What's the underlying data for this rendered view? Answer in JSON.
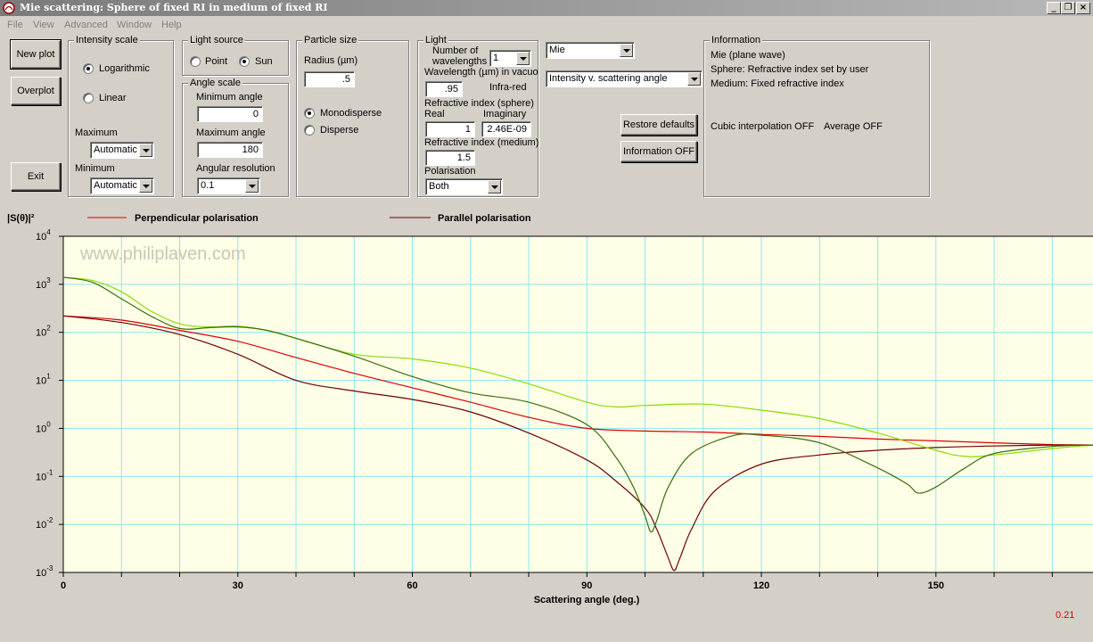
{
  "window": {
    "title": "Mie scattering:  Sphere of fixed RI in medium of fixed RI",
    "controls": {
      "minimize": "_",
      "restore": "❐",
      "close": "×"
    }
  },
  "menu": [
    "File",
    "View",
    "Advanced",
    "Window",
    "Help"
  ],
  "buttons": {
    "new_plot": "New plot",
    "overplot": "Overplot",
    "exit": "Exit",
    "restore_defaults": "Restore defaults",
    "information_off": "Information OFF"
  },
  "intensity_scale": {
    "legend": "Intensity scale",
    "logarithmic": "Logarithmic",
    "linear": "Linear",
    "selected": "Logarithmic",
    "maximum_label": "Maximum",
    "maximum_value": "Automatic",
    "minimum_label": "Minimum",
    "minimum_value": "Automatic"
  },
  "light_source": {
    "legend": "Light source",
    "point": "Point",
    "sun": "Sun",
    "selected": "Sun"
  },
  "angle_scale": {
    "legend": "Angle scale",
    "min_label": "Minimum angle",
    "min_value": "0",
    "max_label": "Maximum angle",
    "max_value": "180",
    "res_label": "Angular resolution",
    "res_value": "0.1"
  },
  "particle_size": {
    "legend": "Particle size",
    "radius_label": "Radius (µm)",
    "radius_value": ".5",
    "monodisperse": "Monodisperse",
    "disperse": "Disperse",
    "selected": "Monodisperse"
  },
  "light": {
    "legend": "Light",
    "num_wl_label_1": "Number of",
    "num_wl_label_2": "wavelengths",
    "num_wl_value": "1",
    "wavelength_label": "Wavelength (µm) in vacuo",
    "wavelength_value": ".95",
    "band": "Infra-red",
    "ri_sphere_label": "Refractive index (sphere)",
    "real_label": "Real",
    "imag_label": "Imaginary",
    "real_value": "1",
    "imag_value": "2.46E-09",
    "ri_medium_label": "Refractive index (medium)",
    "ri_medium_value": "1.5",
    "polarisation_label": "Polarisation",
    "polarisation_value": "Both"
  },
  "model": {
    "theory": "Mie",
    "plot_type": "Intensity v. scattering angle"
  },
  "information": {
    "legend": "Information",
    "line1": "Mie (plane wave)",
    "line2": "Sphere: Refractive index set by user",
    "line3": "Medium: Fixed refractive index",
    "cubic": "Cubic interpolation OFF",
    "average": "Average OFF"
  },
  "colors": {
    "plot_bg": "#ffffe8",
    "grid": "#88e8f0",
    "perp_red": "#dd0000",
    "par_dark": "#700000",
    "green_light": "#88dd00",
    "green_dark": "#3a6e0a"
  },
  "legend": {
    "perpendicular": "Perpendicular polarisation",
    "parallel": "Parallel polarisation"
  },
  "watermark": "www.philiplaven.com",
  "status_value": "0.21",
  "chart_data": {
    "type": "line",
    "ylabel": "|S(θ)|²",
    "xlabel": "Scattering angle (deg.)",
    "xlim": [
      0,
      177
    ],
    "ylim_log10": [
      -3,
      4
    ],
    "y_scale": "log",
    "grid": true,
    "legend_placement": "top",
    "x_ticks": [
      0,
      30,
      60,
      90,
      120,
      150
    ],
    "y_tick_exponents": [
      -3,
      -2,
      -1,
      0,
      1,
      2,
      3,
      4
    ],
    "series": [
      {
        "name": "Perpendicular polarisation",
        "color": "#dd0000",
        "x": [
          0,
          10,
          20,
          30,
          40,
          50,
          60,
          70,
          80,
          90,
          100,
          110,
          120,
          130,
          140,
          150,
          160,
          170,
          177
        ],
        "y": [
          220,
          180,
          110,
          65,
          30,
          14,
          7,
          3.5,
          1.7,
          1.0,
          0.88,
          0.84,
          0.75,
          0.68,
          0.6,
          0.55,
          0.5,
          0.46,
          0.45
        ]
      },
      {
        "name": "Parallel polarisation",
        "color": "#700000",
        "x": [
          0,
          10,
          20,
          30,
          40,
          50,
          60,
          70,
          80,
          90,
          95,
          100,
          102,
          104,
          105,
          106,
          108,
          112,
          120,
          130,
          140,
          150,
          160,
          170,
          177
        ],
        "y": [
          220,
          160,
          90,
          35,
          10,
          6,
          4,
          2.2,
          0.8,
          0.22,
          0.08,
          0.022,
          0.008,
          0.002,
          0.0011,
          0.002,
          0.008,
          0.05,
          0.18,
          0.28,
          0.35,
          0.4,
          0.43,
          0.45,
          0.45
        ]
      },
      {
        "name": "",
        "color": "#88dd00",
        "x": [
          0,
          5,
          10,
          15,
          20,
          25,
          30,
          35,
          40,
          50,
          60,
          70,
          80,
          90,
          95,
          100,
          110,
          120,
          130,
          140,
          150,
          155,
          160,
          170,
          177
        ],
        "y": [
          1400,
          1200,
          700,
          280,
          150,
          130,
          135,
          110,
          75,
          35,
          28,
          18,
          8.5,
          3.5,
          2.8,
          3.0,
          3.2,
          2.4,
          1.6,
          0.8,
          0.35,
          0.26,
          0.28,
          0.38,
          0.45
        ]
      },
      {
        "name": "",
        "color": "#3a6e0a",
        "x": [
          0,
          5,
          10,
          15,
          20,
          25,
          30,
          35,
          40,
          50,
          60,
          70,
          80,
          90,
          95,
          98,
          100,
          101,
          102,
          104,
          108,
          115,
          120,
          130,
          140,
          145,
          147,
          150,
          155,
          160,
          170,
          177
        ],
        "y": [
          1400,
          1100,
          500,
          220,
          120,
          125,
          130,
          110,
          75,
          32,
          12,
          5.5,
          3.5,
          1.2,
          0.25,
          0.06,
          0.015,
          0.007,
          0.012,
          0.06,
          0.3,
          0.7,
          0.72,
          0.5,
          0.15,
          0.07,
          0.045,
          0.06,
          0.15,
          0.3,
          0.42,
          0.45
        ]
      }
    ]
  }
}
